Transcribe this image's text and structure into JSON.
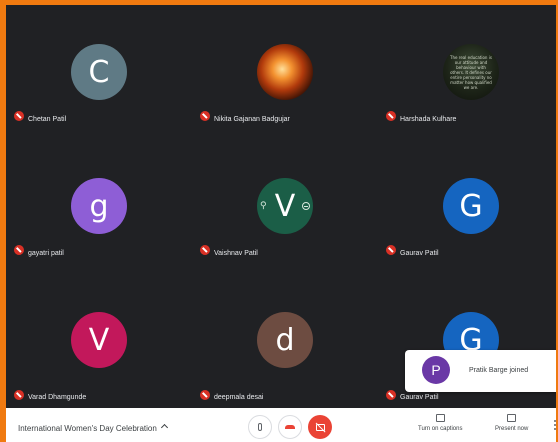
{
  "participants": [
    {
      "name": "Chetan Patil",
      "initial": "C",
      "color": "#5f7a85",
      "type": "initial"
    },
    {
      "name": "Nikita Gajanan Badgujar",
      "initial": "",
      "color": "",
      "type": "photo-fire"
    },
    {
      "name": "Harshada Kulhare",
      "initial": "",
      "color": "",
      "type": "photo-quote",
      "quote": "The real education is our attitude and behaviour with others. It defines our entire personality no matter how qualified we are."
    },
    {
      "name": "gayatri patil",
      "initial": "g",
      "color": "#8e5ed6",
      "type": "initial"
    },
    {
      "name": "Vaishnav Patil",
      "initial": "V",
      "color": "#1b5e47",
      "type": "initial-pinned"
    },
    {
      "name": "Gaurav Patil",
      "initial": "G",
      "color": "#1565c0",
      "type": "initial"
    },
    {
      "name": "Varad Dhamgunde",
      "initial": "V",
      "color": "#c2185b",
      "type": "initial"
    },
    {
      "name": "deepmala desai",
      "initial": "d",
      "color": "#6d4c41",
      "type": "initial"
    },
    {
      "name": "Gaurav Patil",
      "initial": "G",
      "color": "#1565c0",
      "type": "initial"
    }
  ],
  "toast": {
    "initial": "P",
    "message": "Pratik Barge joined"
  },
  "bottom_bar": {
    "meeting_title": "International Women's Day Celebration",
    "captions_label": "Turn on captions",
    "present_label": "Present now"
  },
  "colors": {
    "frame": "#f07a10",
    "grid_bg": "#202124",
    "mute": "#d93025",
    "hangup": "#ea4335"
  }
}
